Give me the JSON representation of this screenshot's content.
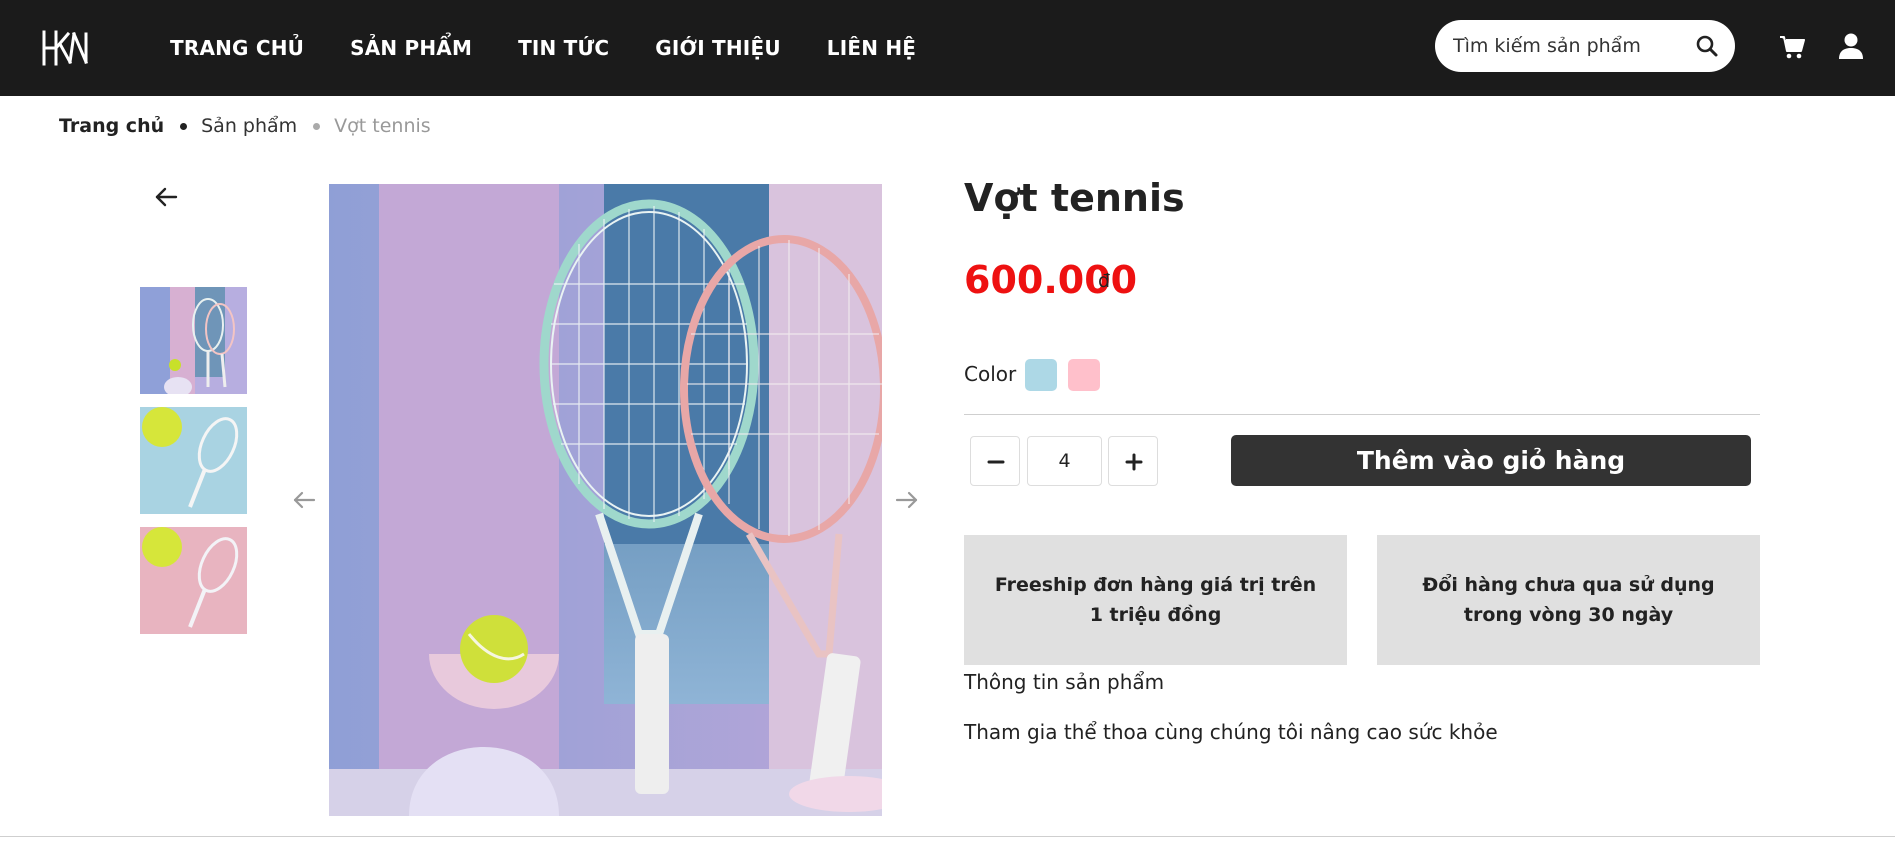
{
  "header": {
    "logo_text": "HKN",
    "nav": [
      "TRANG CHỦ",
      "SẢN PHẨM",
      "TIN TỨC",
      "GIỚI THIỆU",
      "LIÊN HỆ"
    ],
    "search_placeholder": "Tìm kiếm sản phẩm",
    "icons": [
      "search-icon",
      "cart-icon",
      "user-icon"
    ]
  },
  "breadcrumb": {
    "home": "Trang chủ",
    "products": "Sản phẩm",
    "current": "Vợt tennis"
  },
  "gallery": {
    "thumbnails": [
      "tennis rackets teal and pink",
      "tennis racket with ball on blue",
      "tennis racket with ball on pink"
    ],
    "icons": [
      "back-arrow-icon",
      "prev-arrow-icon",
      "next-arrow-icon"
    ]
  },
  "product": {
    "title": "Vợt tennis",
    "price": "600.000",
    "currency": "đ",
    "color_label": "Color",
    "colors": [
      "#add8e6",
      "#ffc0cb"
    ],
    "quantity": "4",
    "add_to_cart": "Thêm vào giỏ hàng",
    "policies": [
      "Freeship đơn hàng giá trị trên 1 triệu đồng",
      "Đổi hàng chưa qua sử dụng trong vòng 30 ngày"
    ],
    "info_heading": "Thông tin sản phẩm",
    "info_description": "Tham gia thể thoa cùng chúng tôi nâng cao sức khỏe"
  },
  "colors": {
    "header_bg": "#1b1b1b",
    "price": "#ee1111",
    "button_bg": "#333333",
    "policy_bg": "#e0e0e0"
  }
}
